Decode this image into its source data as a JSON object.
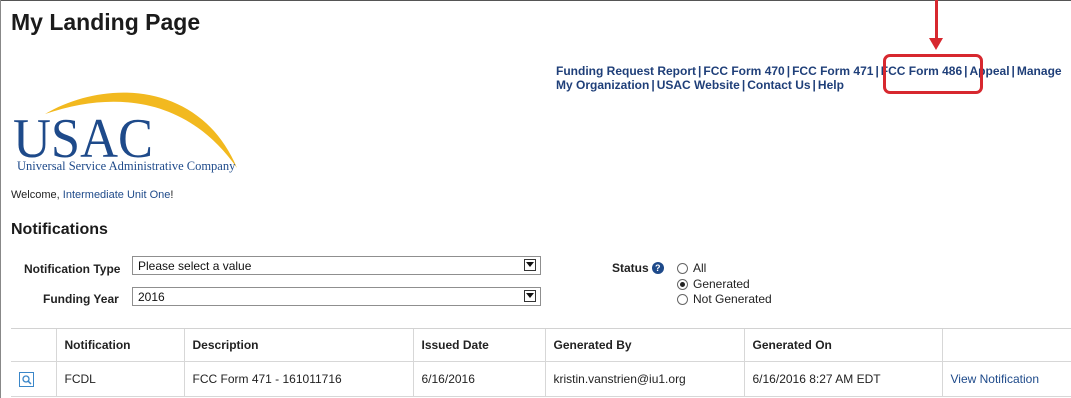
{
  "page": {
    "title": "My Landing Page"
  },
  "top_links": [
    "Funding Request Report",
    "FCC Form 470",
    "FCC Form 471",
    "FCC Form 486",
    "Appeal",
    "Manage",
    "My Organization",
    "USAC Website",
    "Contact Us",
    "Help"
  ],
  "logo": {
    "text": "USAC",
    "tagline": "Universal Service Administrative Company"
  },
  "welcome": {
    "prefix": "Welcome, ",
    "name": "Intermediate Unit One",
    "suffix": "!"
  },
  "notifications": {
    "heading": "Notifications",
    "filters": {
      "notification_type_label": "Notification Type",
      "notification_type_value": "Please select a value",
      "funding_year_label": "Funding Year",
      "funding_year_value": "2016",
      "status_label": "Status",
      "status_options": [
        "All",
        "Generated",
        "Not Generated"
      ],
      "status_selected": "Generated"
    },
    "columns": [
      "",
      "Notification",
      "Description",
      "Issued Date",
      "Generated By",
      "Generated On",
      ""
    ],
    "rows": [
      {
        "notification": "FCDL",
        "description": "FCC Form 471 - 161011716",
        "issued_date": "6/16/2016",
        "generated_by": "kristin.vanstrien@iu1.org",
        "generated_on": "6/16/2016 8:27 AM EDT",
        "action": "View Notification"
      }
    ]
  },
  "colors": {
    "link": "#1f3f79",
    "highlight": "#d7282f",
    "logo_blue": "#1e4a8a",
    "logo_swoosh": "#f2b91f"
  }
}
